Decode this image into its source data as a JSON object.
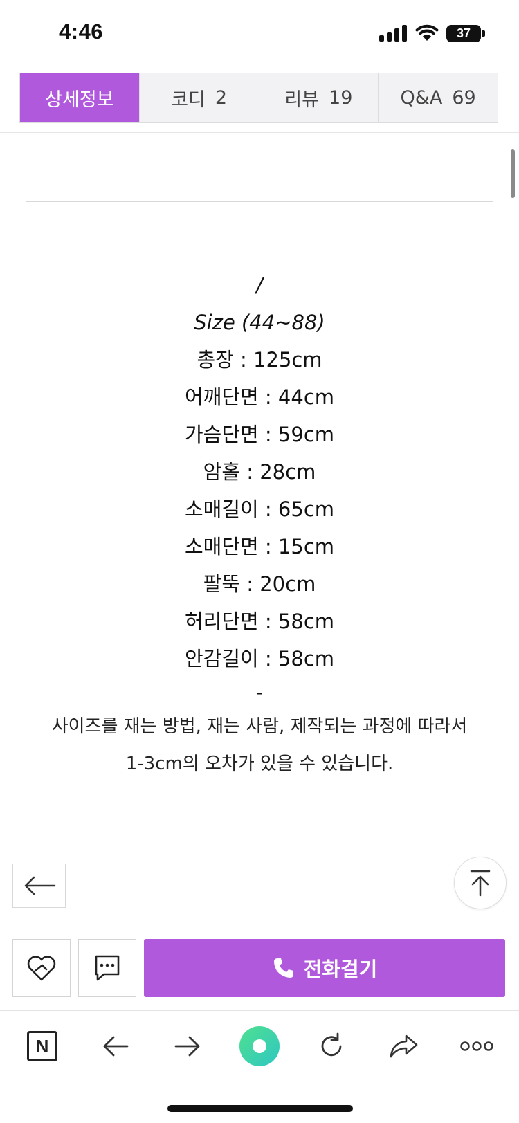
{
  "status_bar": {
    "time": "4:46",
    "battery": "37"
  },
  "tabs": [
    {
      "label": "상세정보",
      "count": ""
    },
    {
      "label": "코디",
      "count": "2"
    },
    {
      "label": "리뷰",
      "count": "19"
    },
    {
      "label": "Q&A",
      "count": "69"
    }
  ],
  "content": {
    "slash": "/",
    "size_heading": "Size (44~88)",
    "measurements": [
      "총장 : 125cm",
      "어깨단면 : 44cm",
      "가슴단면 : 59cm",
      "암홀 : 28cm",
      "소매길이 : 65cm",
      "소매단면 : 15cm",
      "팔뚝 : 20cm",
      "허리단면 : 58cm",
      "안감길이 : 58cm"
    ],
    "dash": "-",
    "notice_line1": "사이즈를 재는 방법, 재는 사람, 제작되는 과정에 따라서",
    "notice_line2": "1-3cm의 오차가 있을 수 있습니다."
  },
  "actions": {
    "call_label": "전화걸기"
  },
  "colors": {
    "accent": "#b159dd"
  },
  "icons": [
    "back-arrow-icon",
    "scroll-top-icon",
    "heart-handshake-icon",
    "chat-bubble-icon",
    "phone-icon",
    "naver-n-icon",
    "forward-arrow-icon",
    "green-dot-icon",
    "refresh-icon",
    "share-icon",
    "more-icon"
  ]
}
